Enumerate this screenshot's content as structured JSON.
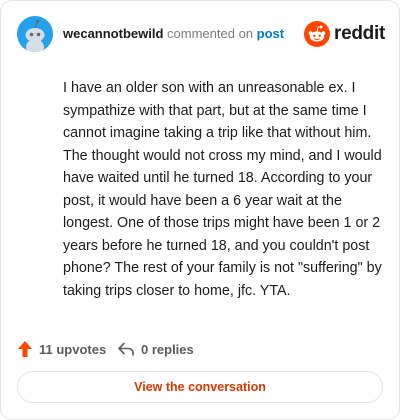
{
  "header": {
    "username": "wecannotbewild",
    "action_text": "commented on",
    "target_text": "post",
    "brand_name": "reddit"
  },
  "comment": {
    "body": "I have an older son with an unreasonable ex. I sympathize with that part, but at the same time I cannot imagine taking a trip like that without him. The thought would not cross my mind, and I would have waited until he turned 18. According to your post, it would have been a 6 year wait at the longest. One of those trips might have been 1 or 2 years before he turned 18, and you couldn't post phone? The rest of your family is not \"suffering\" by taking trips closer to home, jfc. YTA."
  },
  "stats": {
    "upvotes_label": "11 upvotes",
    "replies_label": "0 replies"
  },
  "cta": {
    "label": "View the conversation"
  },
  "colors": {
    "brand_orange": "#ff4500",
    "link_blue": "#0079d3",
    "cta_text": "#d93a00",
    "avatar_bg": "#24a0ed"
  },
  "icons": {
    "avatar": "snoo-avatar-icon",
    "brand": "reddit-logo-icon",
    "upvote": "upvote-arrow-icon",
    "reply": "reply-arrow-icon"
  }
}
